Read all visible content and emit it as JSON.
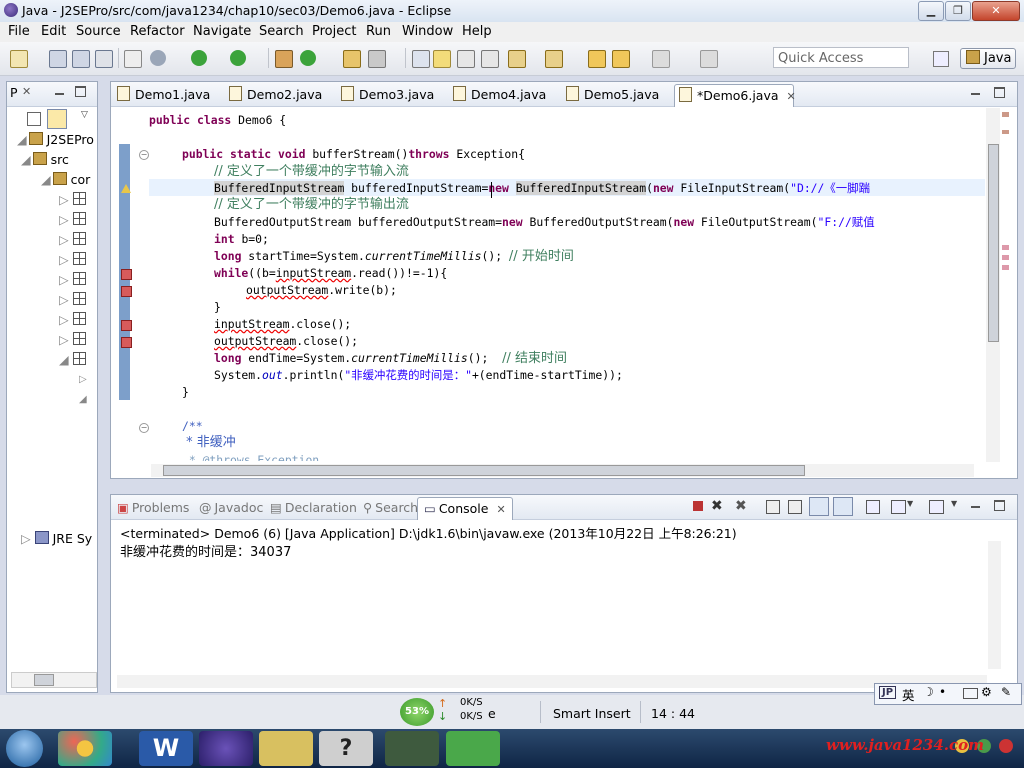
{
  "window": {
    "title": "Java - J2SEPro/src/com/java1234/chap10/sec03/Demo6.java - Eclipse"
  },
  "menu": [
    "File",
    "Edit",
    "Source",
    "Refactor",
    "Navigate",
    "Search",
    "Project",
    "Run",
    "Window",
    "Help"
  ],
  "toolbar": {
    "quick_access": "Quick Access",
    "perspective": "Java"
  },
  "left_view": {
    "tab_label": "P",
    "tree": {
      "project": "J2SEPro",
      "src": "src",
      "pkg": "cor",
      "jre": "JRE Sy"
    }
  },
  "editor": {
    "tabs": [
      "Demo1.java",
      "Demo2.java",
      "Demo3.java",
      "Demo4.java",
      "Demo5.java",
      "*Demo6.java"
    ],
    "code": {
      "l1a": "public class ",
      "l1b": "Demo6 {",
      "l2a": "public static void ",
      "l2b": "bufferStream()",
      "l2c": "throws ",
      "l2d": "Exception{",
      "l3": "// 定义了一个带缓冲的字节输入流",
      "l4a": "BufferedInputStream",
      "l4b": " bufferedInputStream=",
      "l4c": "new ",
      "l4d": "BufferedInputStream",
      "l4e": "(",
      "l4f": "new ",
      "l4g": "FileInputStream(",
      "l4h": "\"D://《一脚踹",
      "l5": "// 定义了一个带缓冲的字节输出流",
      "l6a": "BufferedOutputStream bufferedOutputStream=",
      "l6b": "new ",
      "l6c": "BufferedOutputStream(",
      "l6d": "new ",
      "l6e": "FileOutputStream(",
      "l6f": "\"F://赋值",
      "l7a": "int ",
      "l7b": "b=0;",
      "l8a": "long ",
      "l8b": "startTime=System.",
      "l8c": "currentTimeMillis",
      "l8d": "(); ",
      "l8e": "// 开始时间",
      "l9a": "while",
      "l9b": "((b=",
      "l9c": "inputStream",
      "l9d": ".read())!=-1){",
      "l10a": "outputStream",
      "l10b": ".write(b);",
      "l11": "}",
      "l12a": "inputStream",
      "l12b": ".close();",
      "l13a": "outputStream",
      "l13b": ".close();",
      "l14a": "long ",
      "l14b": "endTime=System.",
      "l14c": "currentTimeMillis",
      "l14d": "();  ",
      "l14e": "// 结束时间",
      "l15a": "System.",
      "l15b": "out",
      "l15c": ".println(",
      "l15d": "\"非缓冲花费的时间是：\"",
      "l15e": "+(endTime-startTime));",
      "l16": "}",
      "l17": "/**",
      "l18": " * 非缓冲",
      "l19": " * @throws Exception"
    }
  },
  "console": {
    "tabs": [
      "Problems",
      "Javadoc",
      "Declaration",
      "Search",
      "Console"
    ],
    "terminated": "<terminated> Demo6 (6) [Java Application] D:\\jdk1.6\\bin\\javaw.exe (2013年10月22日 上午8:26:21)",
    "output": "非缓冲花费的时间是：34037"
  },
  "statusbar": {
    "insert_mode": "Smart Insert",
    "position": "14 : 44",
    "truncated": "e",
    "ime": "英"
  },
  "net_widget": {
    "percent": "53%",
    "up": "0K/S",
    "down": "0K/S"
  },
  "watermark": "www.java1234.com",
  "colors": {
    "keyword": "#7f0055",
    "comment": "#3f7f5f",
    "string": "#2a00ff",
    "field": "#0000c0"
  }
}
